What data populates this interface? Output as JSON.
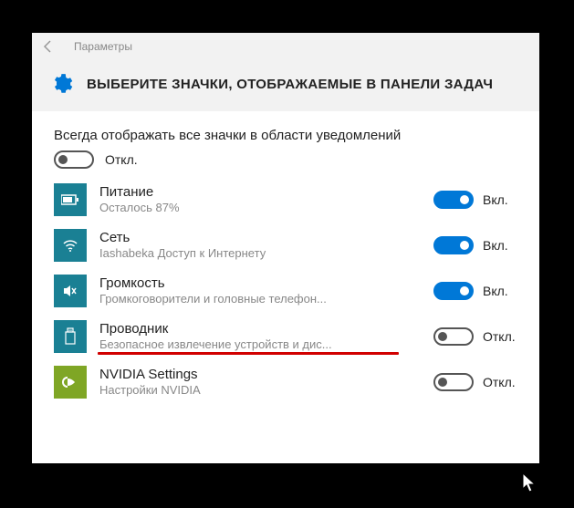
{
  "titlebar": {
    "app_name": "Параметры"
  },
  "header": {
    "title": "ВЫБЕРИТЕ ЗНАЧКИ, ОТОБРАЖАЕМЫЕ В ПАНЕЛИ ЗАДАЧ"
  },
  "master": {
    "subtitle": "Всегда отображать все значки в области уведомлений",
    "state_label": "Откл."
  },
  "labels": {
    "on": "Вкл.",
    "off": "Откл."
  },
  "items": [
    {
      "title": "Питание",
      "desc": "Осталось 87%",
      "on": true,
      "icon": "battery"
    },
    {
      "title": "Сеть",
      "desc": "Iashabeka Доступ к Интернету",
      "on": true,
      "icon": "wifi"
    },
    {
      "title": "Громкость",
      "desc": "Громкоговорители и головные телефон...",
      "on": true,
      "icon": "volume"
    },
    {
      "title": "Проводник",
      "desc": "Безопасное извлечение устройств и дис...",
      "on": false,
      "icon": "usb",
      "underline": true
    },
    {
      "title": "NVIDIA Settings",
      "desc": "Настройки NVIDIA",
      "on": false,
      "icon": "nvidia"
    }
  ]
}
